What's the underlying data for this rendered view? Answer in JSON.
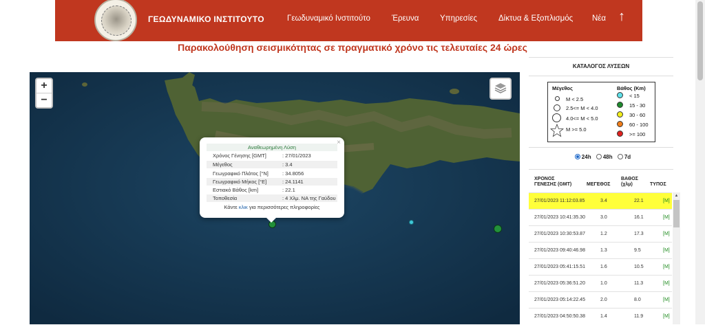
{
  "header": {
    "brand": "ΓΕΩΔΥΝΑΜΙΚΟ ΙΝΣΤΙΤΟΥΤΟ",
    "nav": [
      "Γεωδυναμικό Ινστιτούτο",
      "Έρευνα",
      "Υπηρεσίες",
      "Δίκτυα & Εξοπλισμός",
      "Νέα"
    ],
    "back_to_top": "↑"
  },
  "subtitle": "Παρακολούθηση σεισμικότητας σε πραγματικό χρόνο τις τελευταίες 24 ώρες",
  "map": {
    "zoom_in": "+",
    "zoom_out": "−",
    "layers_icon": "layers-icon",
    "popup": {
      "title": "Αναθεωρημένη Λύση",
      "close": "×",
      "fields": [
        {
          "label": "Χρόνος Γένησης [GMT]",
          "value": ": 27/01/2023 11:12:03.85"
        },
        {
          "label": "Μέγεθος",
          "value": ": 3.4"
        },
        {
          "label": "Γεωγραφικό Πλάτος [°N]",
          "value": ": 34.8056"
        },
        {
          "label": "Γεωγραφικό Μήκος [°E]",
          "value": ": 24.1141"
        },
        {
          "label": "Εστιακό Βάθος [km]",
          "value": ": 22.1"
        },
        {
          "label": "Τοποθεσία",
          "value": ": 4 Χλμ. ΝΑ της Γαύδου"
        }
      ],
      "footer_pre": "Κάντε ",
      "footer_link": "κλικ",
      "footer_post": " για περισσότερες πληροφορίες"
    },
    "colors": {
      "sea": "#163650",
      "marker_green": "#23913a",
      "marker_cyan": "#3ec8d8"
    }
  },
  "panel": {
    "title": "ΚΑΤΑΛΟΓΟΣ ΛΥΣΕΩΝ",
    "legend": {
      "magnitude_title": "Μέγεθος",
      "depth_title": "Βάθος (Km)",
      "magnitudes": [
        "M < 2.5",
        "2.5<= M < 4.0",
        "4.0<= M < 5.0",
        "M >= 5.0"
      ],
      "depths": [
        {
          "label": "< 15",
          "color": "#5fe0e8"
        },
        {
          "label": "15 - 30",
          "color": "#1e8a2e"
        },
        {
          "label": "30 - 60",
          "color": "#f2ee1c"
        },
        {
          "label": "60 - 100",
          "color": "#f07d1a"
        },
        {
          "label": ">= 100",
          "color": "#e0221e"
        }
      ]
    },
    "ranges": [
      {
        "label": "24h",
        "selected": true
      },
      {
        "label": "48h",
        "selected": false
      },
      {
        "label": "7d",
        "selected": false
      }
    ],
    "columns": {
      "time_l1": "ΧΡΟΝΟΣ",
      "time_l2": "ΓΕΝΕΣΗΣ (GMT)",
      "mag": "ΜΕΓΕΘΟΣ",
      "depth_l1": "ΒΑΘΟΣ",
      "depth_l2": "(χλμ)",
      "type": "ΤΥΠΟΣ"
    },
    "rows": [
      {
        "time": "27/01/2023 11:12:03.85",
        "mag": "3.4",
        "depth": "22.1",
        "type": "[M]"
      },
      {
        "time": "27/01/2023 10:41:35.30",
        "mag": "3.0",
        "depth": "16.1",
        "type": "[M]"
      },
      {
        "time": "27/01/2023 10:30:53.87",
        "mag": "1.2",
        "depth": "17.3",
        "type": "[M]"
      },
      {
        "time": "27/01/2023 09:40:46.98",
        "mag": "1.3",
        "depth": "9.5",
        "type": "[M]"
      },
      {
        "time": "27/01/2023 05:41:15.51",
        "mag": "1.6",
        "depth": "10.5",
        "type": "[M]"
      },
      {
        "time": "27/01/2023 05:36:51.20",
        "mag": "1.0",
        "depth": "11.3",
        "type": "[M]"
      },
      {
        "time": "27/01/2023 05:14:22.45",
        "mag": "2.0",
        "depth": "8.0",
        "type": "[M]"
      },
      {
        "time": "27/01/2023 04:50:50.38",
        "mag": "1.4",
        "depth": "11.9",
        "type": "[M]"
      }
    ]
  }
}
